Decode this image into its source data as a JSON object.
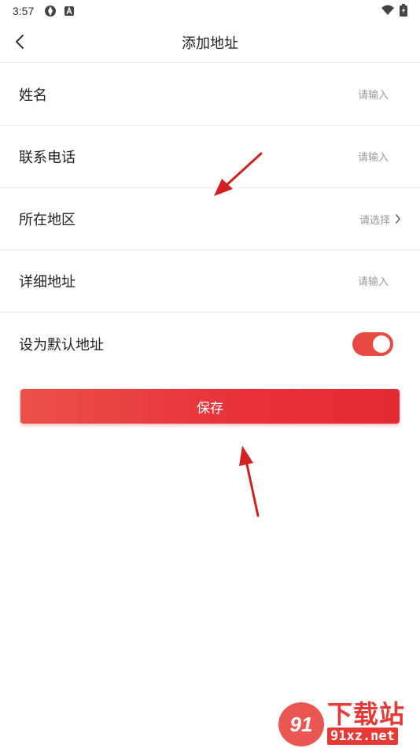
{
  "status_bar": {
    "time": "3:57",
    "icons_left": [
      "sync-icon",
      "a-badge-icon"
    ],
    "icons_right": [
      "wifi-icon",
      "battery-icon"
    ]
  },
  "header": {
    "title": "添加地址",
    "back_icon": "chevron-left-icon"
  },
  "form": {
    "name": {
      "label": "姓名",
      "placeholder": "请输入",
      "value": ""
    },
    "phone": {
      "label": "联系电话",
      "placeholder": "请输入",
      "value": ""
    },
    "region": {
      "label": "所在地区",
      "placeholder": "请选择",
      "icon": "chevron-right-icon"
    },
    "address": {
      "label": "详细地址",
      "placeholder": "请输入",
      "value": ""
    },
    "default": {
      "label": "设为默认地址",
      "enabled": true
    }
  },
  "save_button": {
    "label": "保存"
  },
  "colors": {
    "accent": "#e8303a",
    "toggle_on": "#e84a43",
    "placeholder": "#999999",
    "divider": "#ededed"
  },
  "watermark": {
    "badge": "91",
    "title": "下载站",
    "site": "91xz.net"
  }
}
